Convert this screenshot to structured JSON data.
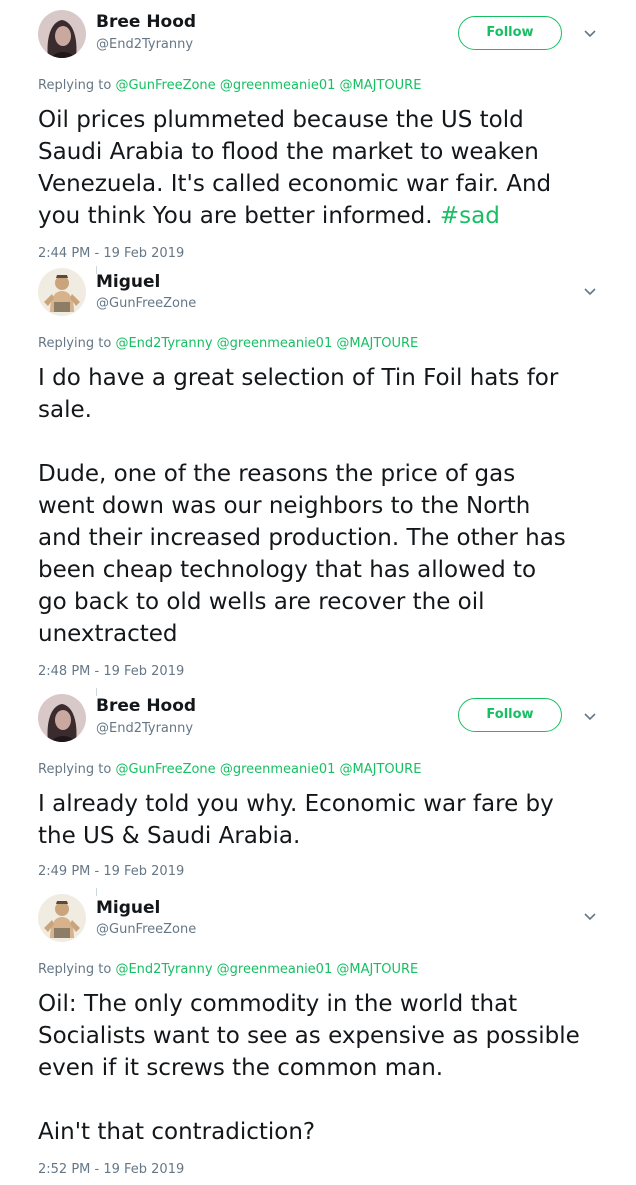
{
  "tweets": [
    {
      "name": "Bree Hood",
      "handle": "@End2Tyranny",
      "follow_label": "Follow",
      "reply_prefix": "Replying to",
      "mentions": [
        "@GunFreeZone",
        "@greenmeanie01",
        "@MAJTOURE"
      ],
      "text": "Oil prices plummeted because the US told\nSaudi Arabia to flood the market to weaken\nVenezuela. It's called economic war fair. And\nyou think You are better informed. ",
      "hashtag": "#sad",
      "timestamp": "2:44 PM - 19 Feb 2019"
    },
    {
      "name": "Miguel",
      "handle": "@GunFreeZone",
      "reply_prefix": "Replying to",
      "mentions": [
        "@End2Tyranny",
        "@greenmeanie01",
        "@MAJTOURE"
      ],
      "text": "I do have a great selection of Tin Foil hats for\nsale.\n\nDude, one of the reasons the price of gas\nwent down was our neighbors to the North\nand their increased production. The other has\nbeen cheap technology that has allowed to\ngo back to old wells are recover the oil\nunextracted",
      "timestamp": "2:48 PM - 19 Feb 2019"
    },
    {
      "name": "Bree Hood",
      "handle": "@End2Tyranny",
      "follow_label": "Follow",
      "reply_prefix": "Replying to",
      "mentions": [
        "@GunFreeZone",
        "@greenmeanie01",
        "@MAJTOURE"
      ],
      "text": "I already told you why. Economic war fare by\nthe US & Saudi Arabia.",
      "timestamp": "2:49 PM - 19 Feb 2019"
    },
    {
      "name": "Miguel",
      "handle": "@GunFreeZone",
      "reply_prefix": "Replying to",
      "mentions": [
        "@End2Tyranny",
        "@greenmeanie01",
        "@MAJTOURE"
      ],
      "text": "Oil: The only commodity in the world that\nSocialists want to see as expensive as possible\neven if it screws the common man.\n\nAin't that contradiction?",
      "timestamp": "2:52 PM - 19 Feb 2019"
    }
  ],
  "colors": {
    "accent": "#17bf63",
    "secondary_text": "#657786",
    "primary_text": "#14171a"
  },
  "icons": {
    "caret": "chevron-down-icon"
  }
}
